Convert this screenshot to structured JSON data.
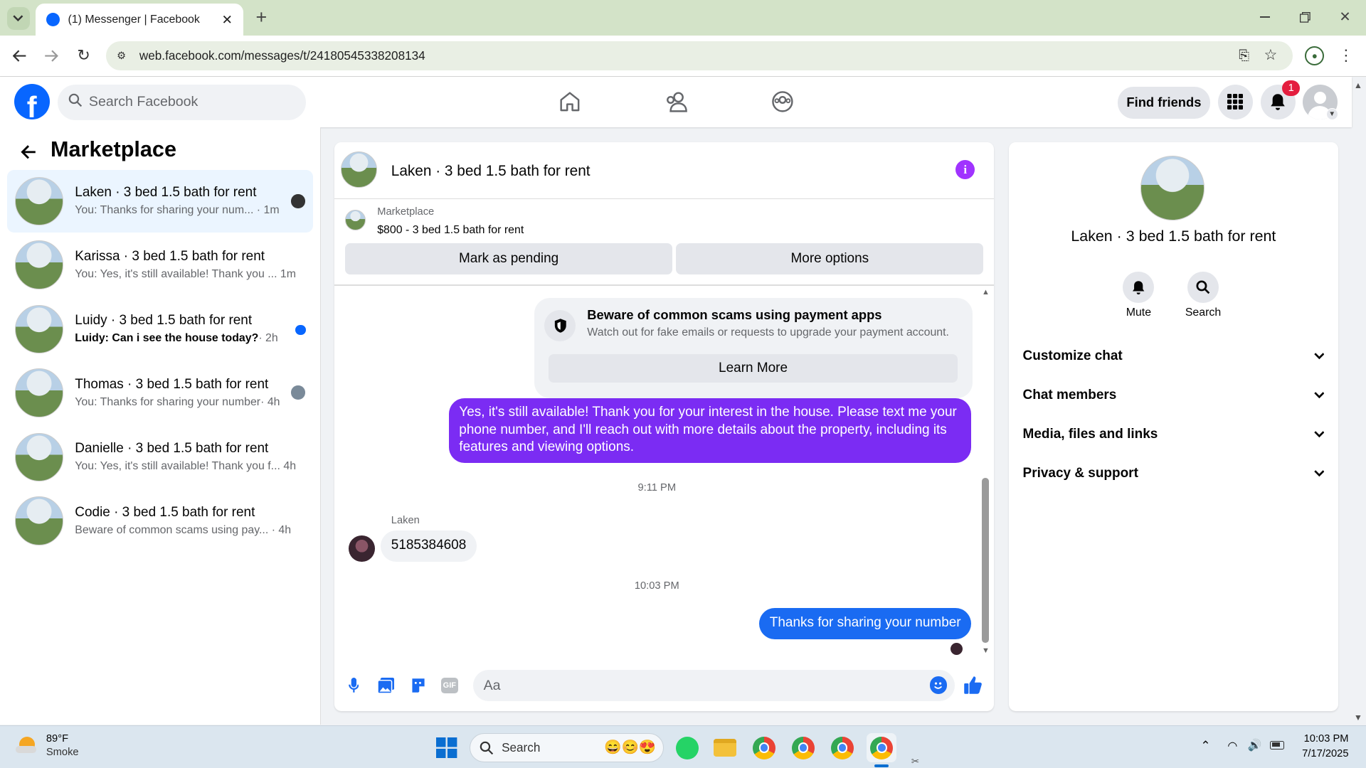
{
  "browser": {
    "tab_title": "(1) Messenger | Facebook",
    "url": "web.facebook.com/messages/t/24180545338208134"
  },
  "header": {
    "search_placeholder": "Search Facebook",
    "find_friends": "Find friends",
    "notif_count": "1"
  },
  "left": {
    "title": "Marketplace",
    "chats": [
      {
        "name": "Laken · 3 bed 1.5 bath for rent",
        "preview": "You: Thanks for sharing your num...",
        "time": "· 1m",
        "selected": true,
        "unread": false
      },
      {
        "name": "Karissa · 3 bed 1.5 bath for rent",
        "preview": "You: Yes, it's still available! Thank you ...",
        "time": "1m",
        "selected": false,
        "unread": false
      },
      {
        "name": "Luidy · 3 bed 1.5 bath for rent",
        "preview": "Luidy: Can i see the house today?",
        "time": "· 2h",
        "selected": false,
        "unread": true
      },
      {
        "name": "Thomas · 3 bed 1.5 bath for rent",
        "preview": "You: Thanks for sharing your number",
        "time": "· 4h",
        "selected": false,
        "unread": false
      },
      {
        "name": "Danielle · 3 bed 1.5 bath for rent",
        "preview": "You: Yes, it's still available! Thank you f...",
        "time": "4h",
        "selected": false,
        "unread": false
      },
      {
        "name": "Codie · 3 bed 1.5 bath for rent",
        "preview": "Beware of common scams using pay...",
        "time": "· 4h",
        "selected": false,
        "unread": false
      }
    ]
  },
  "conversation": {
    "title": "Laken · 3 bed 1.5 bath for rent",
    "listing_source": "Marketplace",
    "listing_desc": "$800 - 3 bed 1.5 bath for rent",
    "mark_pending": "Mark as pending",
    "more_options": "More options",
    "scam_title": "Beware of common scams using payment apps",
    "scam_text": "Watch out for fake emails or requests to upgrade your payment account.",
    "learn_more": "Learn More",
    "msg1": "Yes, it's still available! Thank you for your interest in the house. Please text me your phone number, and I'll reach out with more details about the property, including its features and viewing options.",
    "time1": "9:11 PM",
    "sender": "Laken",
    "msg2": "5185384608",
    "time2": "10:03 PM",
    "msg3": "Thanks for sharing your number",
    "composer_placeholder": "Aa"
  },
  "info": {
    "title": "Laken · 3 bed 1.5 bath for rent",
    "mute": "Mute",
    "search": "Search",
    "sections": [
      "Customize chat",
      "Chat members",
      "Media, files and links",
      "Privacy & support"
    ]
  },
  "taskbar": {
    "weather_temp": "89°F",
    "weather_desc": "Smoke",
    "search": "Search",
    "time": "10:03 PM",
    "date": "7/17/2025"
  },
  "colors": {
    "accent": "#0866ff",
    "purple_bubble": "#7b2cf3",
    "blue_bubble": "#1a6bf2",
    "info_icon": "#a033ff"
  }
}
